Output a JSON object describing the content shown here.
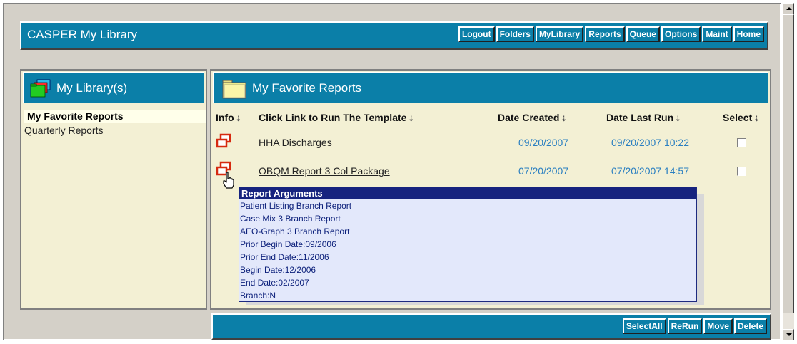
{
  "header": {
    "title": "CASPER My Library",
    "nav": [
      "Logout",
      "Folders",
      "MyLibrary",
      "Reports",
      "Queue",
      "Options",
      "Maint",
      "Home"
    ]
  },
  "library": {
    "title": "My Library(s)",
    "items": [
      {
        "label": "My Favorite Reports",
        "active": true
      },
      {
        "label": "Quarterly Reports",
        "active": false
      }
    ]
  },
  "favorites": {
    "title": "My Favorite Reports",
    "columns": {
      "info": "Info",
      "link": "Click Link to Run The Template",
      "created": "Date Created",
      "last_run": "Date Last Run",
      "select": "Select"
    },
    "sort_glyph": "⇣",
    "rows": [
      {
        "name": "HHA Discharges",
        "created": "09/20/2007",
        "last_run": "09/20/2007 10:22",
        "selected": false
      },
      {
        "name": "OBQM Report 3 Col Package",
        "created": "07/20/2007",
        "last_run": "07/20/2007 14:57",
        "selected": false
      }
    ]
  },
  "tooltip": {
    "title": "Report Arguments",
    "lines": [
      "Patient Listing Branch Report",
      "Case Mix 3 Branch Report",
      "AEO-Graph 3 Branch Report",
      "Prior Begin Date:09/2006",
      "Prior End Date:11/2006",
      "Begin Date:12/2006",
      "End Date:02/2007",
      "Branch:N"
    ]
  },
  "actions": [
    "SelectAll",
    "ReRun",
    "Move",
    "Delete"
  ],
  "colors": {
    "bar": "#0b7fa8",
    "panel": "#f3f0d4",
    "date_text": "#2a7fc1",
    "tooltip_head": "#16237f",
    "tooltip_bg": "#e3e8fb"
  }
}
